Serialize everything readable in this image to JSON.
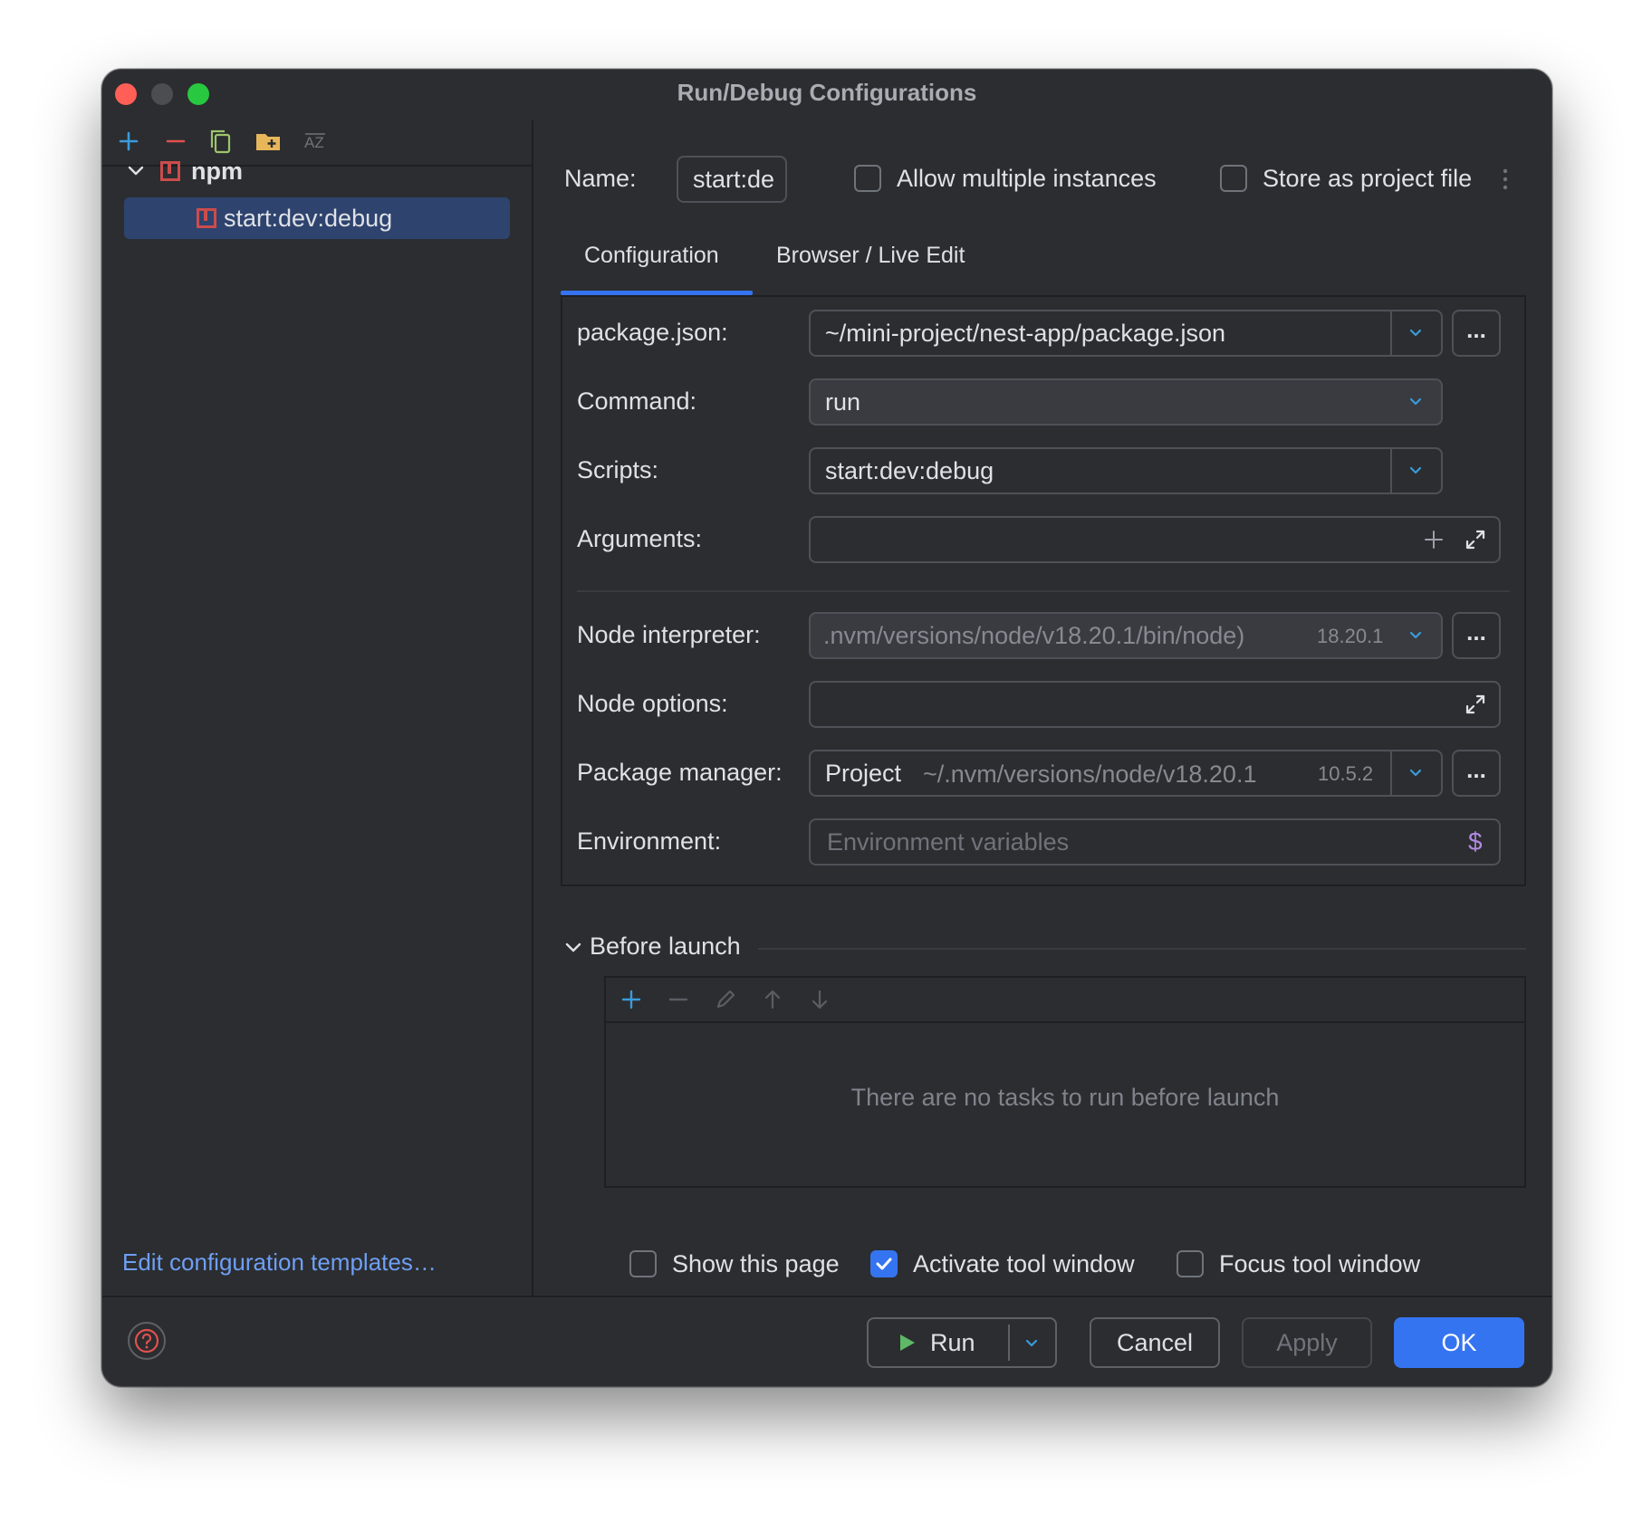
{
  "window": {
    "title": "Run/Debug Configurations"
  },
  "sidebar": {
    "toolbar_icons": [
      "add-icon",
      "remove-icon",
      "copy-icon",
      "folder-add-icon",
      "sort-az-icon"
    ],
    "tree": {
      "group_label": "npm",
      "items": [
        {
          "label": "start:dev:debug",
          "selected": true
        }
      ]
    },
    "edit_templates_link": "Edit configuration templates…"
  },
  "header": {
    "name_label": "Name:",
    "name_value": "start:de",
    "allow_multiple_label": "Allow multiple instances",
    "allow_multiple_checked": false,
    "store_project_label": "Store as project file",
    "store_project_checked": false
  },
  "tabs": [
    {
      "label": "Configuration",
      "active": true
    },
    {
      "label": "Browser / Live Edit",
      "active": false
    }
  ],
  "form": {
    "package_json": {
      "label": "package.json:",
      "value": "~/mini-project/nest-app/package.json"
    },
    "command": {
      "label": "Command:",
      "value": "run"
    },
    "scripts": {
      "label": "Scripts:",
      "value": "start:dev:debug"
    },
    "arguments": {
      "label": "Arguments:",
      "value": ""
    },
    "node_interpreter": {
      "label": "Node interpreter:",
      "value": ".nvm/versions/node/v18.20.1/bin/node)",
      "version": "18.20.1"
    },
    "node_options": {
      "label": "Node options:",
      "value": ""
    },
    "package_manager": {
      "label": "Package manager:",
      "value": "Project",
      "path": "~/.nvm/versions/node/v18.20.1",
      "version": "10.5.2"
    },
    "environment": {
      "label": "Environment:",
      "placeholder": "Environment variables"
    },
    "browse_button_label": "..."
  },
  "before_launch": {
    "title": "Before launch",
    "empty_text": "There are no tasks to run before launch",
    "toolbar_icons": [
      "add-icon",
      "remove-icon",
      "edit-icon",
      "arrow-up-icon",
      "arrow-down-icon"
    ]
  },
  "options": {
    "show_page": {
      "label": "Show this page",
      "checked": false
    },
    "activate_tool": {
      "label": "Activate tool window",
      "checked": true
    },
    "focus_tool": {
      "label": "Focus tool window",
      "checked": false
    }
  },
  "footer": {
    "run_label": "Run",
    "cancel_label": "Cancel",
    "apply_label": "Apply",
    "ok_label": "OK"
  },
  "colors": {
    "accent": "#3574f0",
    "background": "#2b2d30",
    "selection": "#2e436e",
    "link": "#6f9ff5",
    "close": "#ff5f57",
    "maximize": "#28c840",
    "npm_icon": "#cc4c4c",
    "folder_icon": "#e8b65a",
    "env_icon": "#b08ae0"
  }
}
